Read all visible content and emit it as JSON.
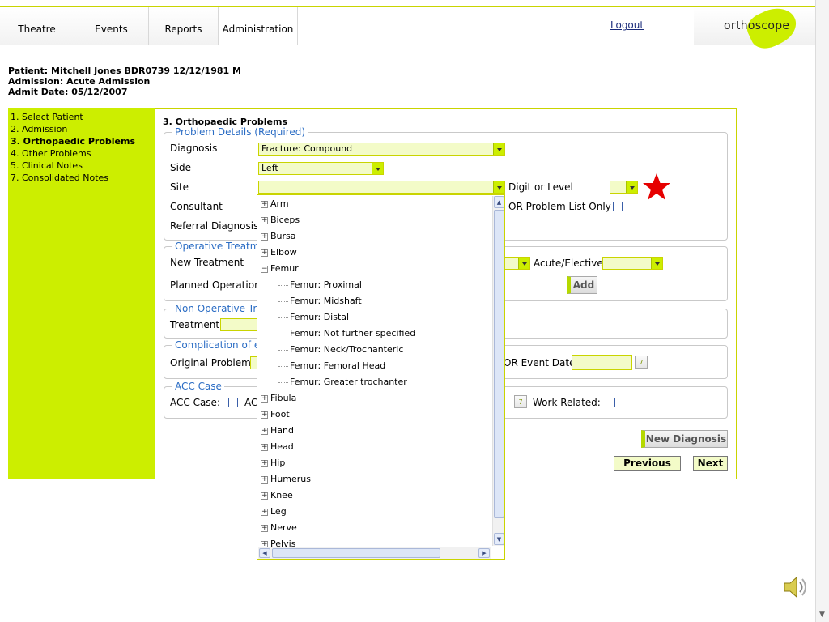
{
  "nav": {
    "tabs": [
      "Theatre",
      "Events",
      "Reports",
      "Administration"
    ],
    "active": "Administration",
    "logout": "Logout",
    "logo": "orthoscope"
  },
  "patient": {
    "line1": "Patient: Mitchell Jones BDR0739 12/12/1981 M",
    "line2": "Admission: Acute Admission",
    "line3": "Admit Date: 05/12/2007"
  },
  "sidebar": {
    "items": [
      "1. Select Patient",
      "2. Admission",
      "3. Orthopaedic Problems",
      "4. Other Problems",
      "5. Clinical Notes",
      "7. Consolidated Notes"
    ],
    "current": "3. Orthopaedic Problems"
  },
  "main": {
    "section_title": "3. Orthopaedic Problems",
    "problem_details": {
      "legend": "Problem Details (Required)",
      "diagnosis_label": "Diagnosis",
      "diagnosis_value": "Fracture: Compound",
      "side_label": "Side",
      "side_value": "Left",
      "site_label": "Site",
      "site_value": "",
      "digit_label": "Digit or Level",
      "consultant_label": "Consultant",
      "or_problem_label": "OR Problem List Only",
      "referral_label": "Referral Diagnosis"
    },
    "operative": {
      "legend": "Operative Treatm",
      "new_treatment_label": "New Treatment",
      "acute_label": "Acute/Elective",
      "planned_label": "Planned Operation",
      "add_button": "Add"
    },
    "non_operative": {
      "legend": "Non Operative Tre",
      "treatment_label": "Treatment"
    },
    "complication": {
      "legend": "Complication of e",
      "original_label": "Original Problem",
      "event_date_label": "OR Event Date"
    },
    "acc": {
      "legend": "ACC Case",
      "acc_case_label": "ACC Case:",
      "acc_partial": "AC",
      "work_related_label": "Work Related:"
    },
    "new_diagnosis_button": "New Diagnosis",
    "previous_button": "Previous",
    "next_button": "Next"
  },
  "site_tree": {
    "top": [
      "Arm",
      "Biceps",
      "Bursa",
      "Elbow"
    ],
    "expanded": "Femur",
    "children": [
      "Femur: Proximal",
      "Femur: Midshaft",
      "Femur: Distal",
      "Femur: Not further specified",
      "Femur: Neck/Trochanteric",
      "Femur: Femoral Head",
      "Femur: Greater trochanter"
    ],
    "highlighted": "Femur: Midshaft",
    "rest": [
      "Fibula",
      "Foot",
      "Hand",
      "Head",
      "Hip",
      "Humerus",
      "Knee",
      "Leg",
      "Nerve",
      "Pelvis"
    ]
  },
  "colors": {
    "accent": "#ccee00",
    "legend_blue": "#2a6cc4",
    "star_red": "#e60000"
  },
  "icons": [
    "star-icon",
    "calendar-icon",
    "speaker-icon",
    "plus-icon",
    "minus-icon"
  ]
}
